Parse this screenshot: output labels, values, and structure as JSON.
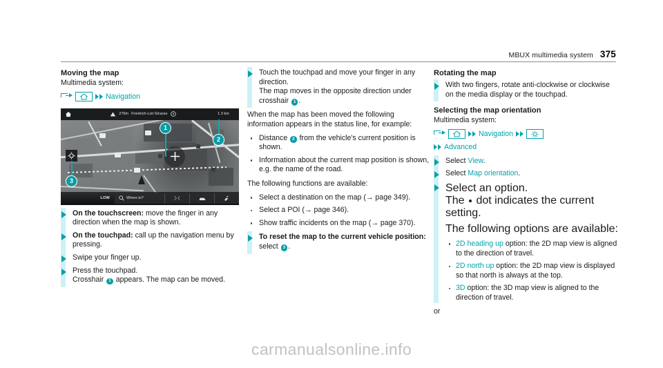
{
  "header": {
    "title": "MBUX multimedia system",
    "page_number": "375"
  },
  "colors": {
    "accent_teal": "#00a3ab",
    "badge_teal": "#0b9ba4",
    "rail_cyan": "#cdf1f4",
    "text": "#1a1a1a"
  },
  "left_column": {
    "section_title": "Moving the map",
    "system_label": "Multimedia system:",
    "path": {
      "home_icon": "home-icon",
      "label": "Navigation"
    },
    "map": {
      "topbar": {
        "warning_icon": "warning-triangle-icon",
        "distance": "270m",
        "street": "Friedrich-List-Strasse",
        "compass_icon": "compass-icon",
        "remaining": "1.3 km",
        "home_icon": "home-icon"
      },
      "locate_icon": "locate-compass-icon",
      "crosshair_icon": "crosshair-icon",
      "botbar": {
        "traffic_level": "LOW",
        "search_label": "Where to?",
        "search_icon": "search-icon",
        "route_icon": "route-icon",
        "car_icon": "car-icon",
        "settings_icon": "tools-icon"
      },
      "callouts": [
        {
          "id": "1",
          "label": "1"
        },
        {
          "id": "2",
          "label": "2"
        },
        {
          "id": "3",
          "label": "3"
        }
      ]
    },
    "steps": [
      {
        "bold": "On the touchscreen:",
        "rest": " move the finger in any direction when the map is shown."
      },
      {
        "bold": "On the touchpad:",
        "rest": " call up the navigation menu by pressing."
      },
      {
        "bold": "",
        "rest": "Swipe your finger up."
      }
    ],
    "last_step": {
      "line1": "Press the touchpad.",
      "line2_pre": "Crosshair ",
      "badge": "1",
      "line2_post": " appears. The map can be moved."
    }
  },
  "mid_column": {
    "step1": {
      "line1": "Touch the touchpad and move your finger in any direction.",
      "line2_pre": "The map moves in the opposite direction under crosshair ",
      "badge": "1",
      "line2_post": "."
    },
    "para1": "When the map has been moved the following information appears in the status line, for example:",
    "bullets1": [
      {
        "pre": "Distance ",
        "badge": "2",
        "post": " from the vehicle's current position is shown."
      },
      {
        "pre": "Information about the current map position is shown, e.g. the name of the road.",
        "badge": "",
        "post": ""
      }
    ],
    "para2": "The following functions are available:",
    "bullets2": [
      "Select a destination on the map (→ page 349).",
      "Select a POI (→ page 346).",
      "Show traffic incidents on the map (→ page 370)."
    ],
    "last_step": {
      "bold": "To reset the map to the current vehicle position:",
      "rest": " select ",
      "badge": "3",
      "post": "."
    }
  },
  "right_column": {
    "section1_title": "Rotating the map",
    "section1_step": "With two fingers, rotate anti-clockwise or clockwise on the media display or the touchpad.",
    "section2_title": "Selecting the map orientation",
    "system_label": "Multimedia system:",
    "path": {
      "home_icon": "home-icon",
      "label1": "Navigation",
      "gear_icon": "gear-icon",
      "label2": "Advanced"
    },
    "steps": [
      {
        "pre": "Select ",
        "link": "View",
        "post": "."
      },
      {
        "pre": "Select ",
        "link": "Map orientation",
        "post": "."
      }
    ],
    "option_step": {
      "line1": "Select an option.",
      "line2_pre": "The ",
      "line2_post": " dot indicates the current setting.",
      "line3": "The following options are available:",
      "options": [
        {
          "link": "2D heading up",
          "post": " option: the 2D map view is aligned to the direction of travel."
        },
        {
          "link": "2D north up",
          "post": " option: the 2D map view is displayed so that north is always at the top."
        },
        {
          "link": "3D",
          "post": " option: the 3D map view is aligned to the direction of travel."
        }
      ]
    },
    "or_label": "or"
  },
  "watermark": "carmanualsonline.info"
}
